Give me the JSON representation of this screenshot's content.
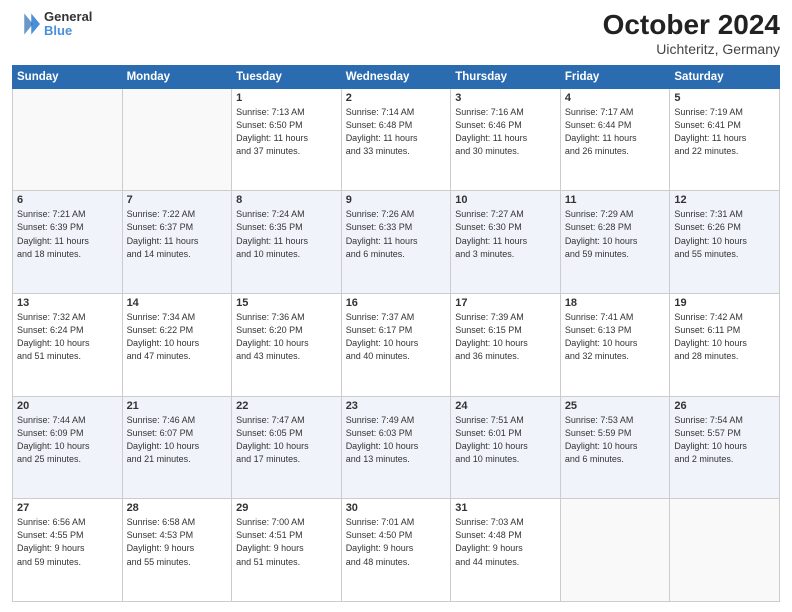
{
  "header": {
    "logo_line1": "General",
    "logo_line2": "Blue",
    "month": "October 2024",
    "location": "Uichteritz, Germany"
  },
  "columns": [
    "Sunday",
    "Monday",
    "Tuesday",
    "Wednesday",
    "Thursday",
    "Friday",
    "Saturday"
  ],
  "weeks": [
    [
      {
        "day": "",
        "info": ""
      },
      {
        "day": "",
        "info": ""
      },
      {
        "day": "1",
        "info": "Sunrise: 7:13 AM\nSunset: 6:50 PM\nDaylight: 11 hours\nand 37 minutes."
      },
      {
        "day": "2",
        "info": "Sunrise: 7:14 AM\nSunset: 6:48 PM\nDaylight: 11 hours\nand 33 minutes."
      },
      {
        "day": "3",
        "info": "Sunrise: 7:16 AM\nSunset: 6:46 PM\nDaylight: 11 hours\nand 30 minutes."
      },
      {
        "day": "4",
        "info": "Sunrise: 7:17 AM\nSunset: 6:44 PM\nDaylight: 11 hours\nand 26 minutes."
      },
      {
        "day": "5",
        "info": "Sunrise: 7:19 AM\nSunset: 6:41 PM\nDaylight: 11 hours\nand 22 minutes."
      }
    ],
    [
      {
        "day": "6",
        "info": "Sunrise: 7:21 AM\nSunset: 6:39 PM\nDaylight: 11 hours\nand 18 minutes."
      },
      {
        "day": "7",
        "info": "Sunrise: 7:22 AM\nSunset: 6:37 PM\nDaylight: 11 hours\nand 14 minutes."
      },
      {
        "day": "8",
        "info": "Sunrise: 7:24 AM\nSunset: 6:35 PM\nDaylight: 11 hours\nand 10 minutes."
      },
      {
        "day": "9",
        "info": "Sunrise: 7:26 AM\nSunset: 6:33 PM\nDaylight: 11 hours\nand 6 minutes."
      },
      {
        "day": "10",
        "info": "Sunrise: 7:27 AM\nSunset: 6:30 PM\nDaylight: 11 hours\nand 3 minutes."
      },
      {
        "day": "11",
        "info": "Sunrise: 7:29 AM\nSunset: 6:28 PM\nDaylight: 10 hours\nand 59 minutes."
      },
      {
        "day": "12",
        "info": "Sunrise: 7:31 AM\nSunset: 6:26 PM\nDaylight: 10 hours\nand 55 minutes."
      }
    ],
    [
      {
        "day": "13",
        "info": "Sunrise: 7:32 AM\nSunset: 6:24 PM\nDaylight: 10 hours\nand 51 minutes."
      },
      {
        "day": "14",
        "info": "Sunrise: 7:34 AM\nSunset: 6:22 PM\nDaylight: 10 hours\nand 47 minutes."
      },
      {
        "day": "15",
        "info": "Sunrise: 7:36 AM\nSunset: 6:20 PM\nDaylight: 10 hours\nand 43 minutes."
      },
      {
        "day": "16",
        "info": "Sunrise: 7:37 AM\nSunset: 6:17 PM\nDaylight: 10 hours\nand 40 minutes."
      },
      {
        "day": "17",
        "info": "Sunrise: 7:39 AM\nSunset: 6:15 PM\nDaylight: 10 hours\nand 36 minutes."
      },
      {
        "day": "18",
        "info": "Sunrise: 7:41 AM\nSunset: 6:13 PM\nDaylight: 10 hours\nand 32 minutes."
      },
      {
        "day": "19",
        "info": "Sunrise: 7:42 AM\nSunset: 6:11 PM\nDaylight: 10 hours\nand 28 minutes."
      }
    ],
    [
      {
        "day": "20",
        "info": "Sunrise: 7:44 AM\nSunset: 6:09 PM\nDaylight: 10 hours\nand 25 minutes."
      },
      {
        "day": "21",
        "info": "Sunrise: 7:46 AM\nSunset: 6:07 PM\nDaylight: 10 hours\nand 21 minutes."
      },
      {
        "day": "22",
        "info": "Sunrise: 7:47 AM\nSunset: 6:05 PM\nDaylight: 10 hours\nand 17 minutes."
      },
      {
        "day": "23",
        "info": "Sunrise: 7:49 AM\nSunset: 6:03 PM\nDaylight: 10 hours\nand 13 minutes."
      },
      {
        "day": "24",
        "info": "Sunrise: 7:51 AM\nSunset: 6:01 PM\nDaylight: 10 hours\nand 10 minutes."
      },
      {
        "day": "25",
        "info": "Sunrise: 7:53 AM\nSunset: 5:59 PM\nDaylight: 10 hours\nand 6 minutes."
      },
      {
        "day": "26",
        "info": "Sunrise: 7:54 AM\nSunset: 5:57 PM\nDaylight: 10 hours\nand 2 minutes."
      }
    ],
    [
      {
        "day": "27",
        "info": "Sunrise: 6:56 AM\nSunset: 4:55 PM\nDaylight: 9 hours\nand 59 minutes."
      },
      {
        "day": "28",
        "info": "Sunrise: 6:58 AM\nSunset: 4:53 PM\nDaylight: 9 hours\nand 55 minutes."
      },
      {
        "day": "29",
        "info": "Sunrise: 7:00 AM\nSunset: 4:51 PM\nDaylight: 9 hours\nand 51 minutes."
      },
      {
        "day": "30",
        "info": "Sunrise: 7:01 AM\nSunset: 4:50 PM\nDaylight: 9 hours\nand 48 minutes."
      },
      {
        "day": "31",
        "info": "Sunrise: 7:03 AM\nSunset: 4:48 PM\nDaylight: 9 hours\nand 44 minutes."
      },
      {
        "day": "",
        "info": ""
      },
      {
        "day": "",
        "info": ""
      }
    ]
  ]
}
